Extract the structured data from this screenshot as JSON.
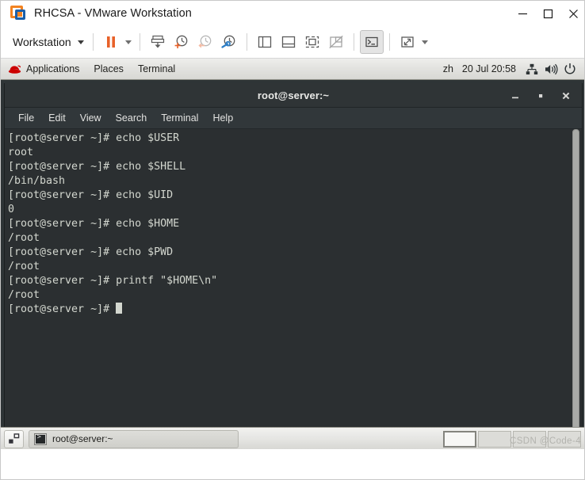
{
  "vmware": {
    "title": "RHCSA - VMware Workstation",
    "logo_icon": "vmware-logo-icon",
    "window_buttons": [
      {
        "name": "minimize-button",
        "icon": "minimize-icon"
      },
      {
        "name": "maximize-button",
        "icon": "maximize-icon"
      },
      {
        "name": "close-button",
        "icon": "close-icon"
      }
    ],
    "toolbar": {
      "workstation_label": "Workstation",
      "buttons": [
        {
          "name": "suspend-button",
          "icon": "pause-icon"
        },
        {
          "name": "power-dropdown",
          "icon": "chevron-down-icon"
        },
        {
          "name": "manage-snapshots-button",
          "icon": "snapshot-save-icon"
        },
        {
          "name": "take-snapshot-button",
          "icon": "snapshot-add-icon"
        },
        {
          "name": "revert-snapshot-button",
          "icon": "snapshot-revert-icon"
        },
        {
          "name": "snapshot-manager-button",
          "icon": "snapshot-manager-icon"
        },
        {
          "name": "show-library-button",
          "icon": "sidebar-panel-icon"
        },
        {
          "name": "show-thumbnails-button",
          "icon": "bottom-panel-icon"
        },
        {
          "name": "fullscreen-button",
          "icon": "fullscreen-icon"
        },
        {
          "name": "unity-mode-button",
          "icon": "unity-disabled-icon"
        },
        {
          "name": "console-view-button",
          "icon": "console-prompt-icon"
        },
        {
          "name": "stretch-view-button",
          "icon": "stretch-arrows-icon"
        },
        {
          "name": "stretch-dropdown",
          "icon": "chevron-down-icon"
        }
      ]
    }
  },
  "gnome": {
    "panel": {
      "redhat_icon": "redhat-hat-icon",
      "menus": [
        "Applications",
        "Places",
        "Terminal"
      ],
      "input_method": "zh",
      "clock": "20 Jul  20:58",
      "tray": [
        {
          "name": "network-icon",
          "icon": "network-wired-icon"
        },
        {
          "name": "volume-icon",
          "icon": "speaker-icon"
        },
        {
          "name": "power-menu-icon",
          "icon": "power-icon"
        }
      ]
    },
    "bottom_panel": {
      "show_desktop_icon": "show-desktop-icon",
      "task": {
        "label": "root@server:~",
        "icon": "terminal-icon"
      },
      "workspaces": [
        {
          "label": "workspace-1",
          "selected": true
        },
        {
          "label": "workspace-2",
          "selected": false
        },
        {
          "label": "workspace-3",
          "selected": false
        },
        {
          "label": "workspace-4",
          "selected": false
        }
      ],
      "watermark": "CSDN @Code-4"
    }
  },
  "terminal": {
    "title": "root@server:~",
    "window_buttons": [
      {
        "name": "term-minimize-button",
        "icon": "minimize-icon"
      },
      {
        "name": "term-maximize-button",
        "icon": "maximize-icon"
      },
      {
        "name": "term-close-button",
        "icon": "close-icon"
      }
    ],
    "menus": [
      "File",
      "Edit",
      "View",
      "Search",
      "Terminal",
      "Help"
    ],
    "prompt": "[root@server ~]# ",
    "lines": [
      "[root@server ~]# echo $USER",
      "root",
      "[root@server ~]# echo $SHELL",
      "/bin/bash",
      "[root@server ~]# echo $UID",
      "0",
      "[root@server ~]# echo $HOME",
      "/root",
      "[root@server ~]# echo $PWD",
      "/root",
      "[root@server ~]# printf \"$HOME\\n\"",
      "/root"
    ],
    "last_prompt": "[root@server ~]# "
  },
  "colors": {
    "vmware_orange": "#f28322",
    "vmware_blue": "#1c5fa8",
    "terminal_bg": "#2b2f31",
    "terminal_fg": "#d3d7cf",
    "titlebar_bg": "#2f3436",
    "panel_bg": "#e2e2df"
  }
}
